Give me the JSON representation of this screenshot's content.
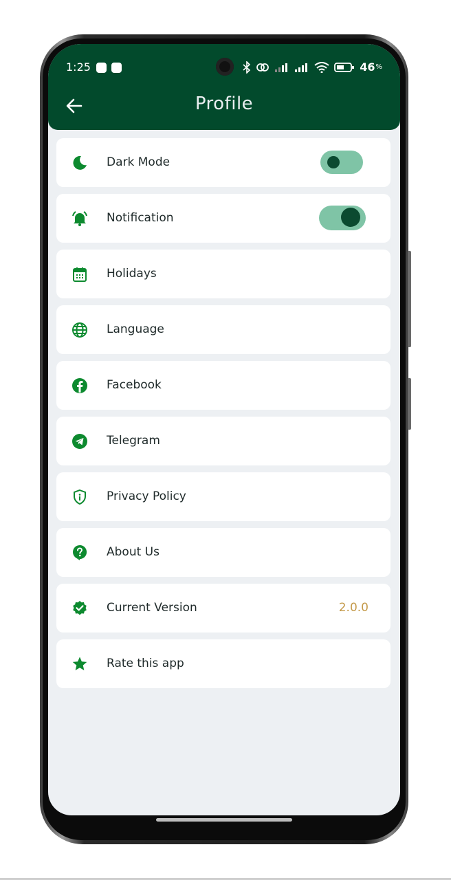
{
  "status_bar": {
    "time": "1:25",
    "battery": "46"
  },
  "header": {
    "title": "Profile"
  },
  "settings": [
    {
      "label": "Dark Mode",
      "icon": "moon-icon",
      "toggle": false
    },
    {
      "label": "Notification",
      "icon": "bell-icon",
      "toggle": true
    },
    {
      "label": "Holidays",
      "icon": "calendar-icon"
    },
    {
      "label": "Language",
      "icon": "globe-icon"
    },
    {
      "label": "Facebook",
      "icon": "facebook-icon"
    },
    {
      "label": "Telegram",
      "icon": "telegram-icon"
    },
    {
      "label": "Privacy Policy",
      "icon": "shield-icon"
    },
    {
      "label": "About Us",
      "icon": "help-icon"
    },
    {
      "label": "Current Version",
      "icon": "verified-icon",
      "value": "2.0.0"
    },
    {
      "label": "Rate this app",
      "icon": "star-icon"
    }
  ],
  "colors": {
    "appbar": "#024a2c",
    "icon": "#0d8a2f",
    "toggle_track": "#7fc4a6",
    "toggle_knob": "#0b4a30",
    "version": "#c49a4a",
    "background": "#edf0f3"
  }
}
